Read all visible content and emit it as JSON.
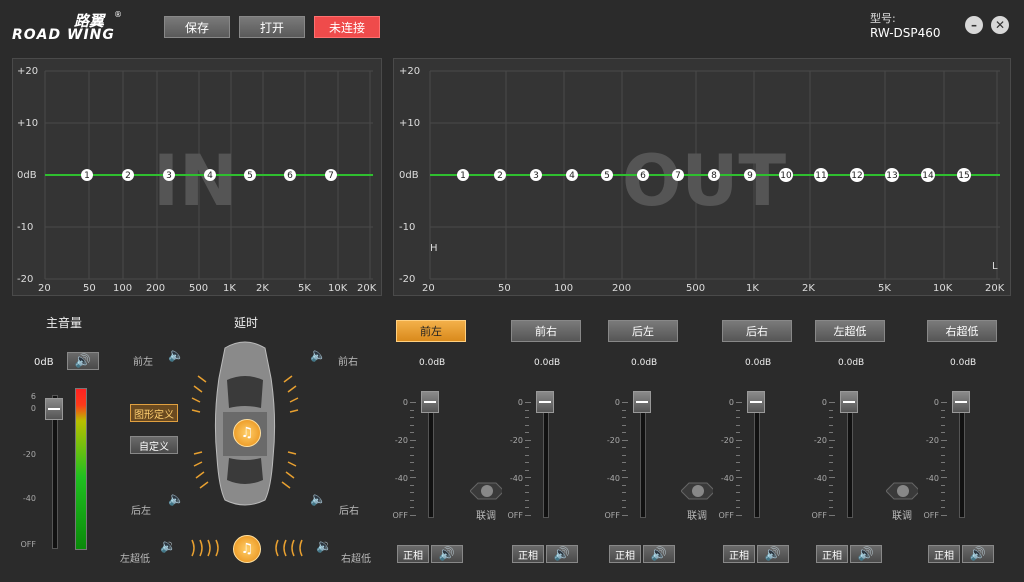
{
  "header": {
    "logo_cn": "路翼",
    "logo_reg": "®",
    "logo_en": "ROAD WING",
    "save": "保存",
    "open": "打开",
    "status": "未连接",
    "model_label": "型号:",
    "model_value": "RW-DSP460",
    "minimize": "–",
    "close": "✕"
  },
  "eq_in": {
    "watermark": "IN",
    "y_ticks": [
      "+20",
      "+10",
      "0dB",
      "-10",
      "-20"
    ],
    "x_ticks": [
      "20",
      "50",
      "100",
      "200",
      "500",
      "1K",
      "2K",
      "5K",
      "10K",
      "20K"
    ],
    "points": [
      "1",
      "2",
      "3",
      "4",
      "5",
      "6",
      "7"
    ]
  },
  "eq_out": {
    "watermark": "OUT",
    "y_ticks": [
      "+20",
      "+10",
      "0dB",
      "-10",
      "-20"
    ],
    "x_ticks": [
      "20",
      "50",
      "100",
      "200",
      "500",
      "1K",
      "2K",
      "5K",
      "10K",
      "20K"
    ],
    "points": [
      "1",
      "2",
      "3",
      "4",
      "5",
      "6",
      "7",
      "8",
      "9",
      "10",
      "11",
      "12",
      "13",
      "14",
      "15"
    ],
    "marker_h": "H",
    "marker_l": "L"
  },
  "master": {
    "title": "主音量",
    "value": "0dB",
    "scale": [
      "6",
      "0",
      "-20",
      "-40",
      "OFF"
    ]
  },
  "delay": {
    "title": "延时",
    "front_left": "前左",
    "front_right": "前右",
    "rear_left": "后左",
    "rear_right": "后右",
    "sub_left": "左超低",
    "sub_right": "右超低",
    "graph_define": "图形定义",
    "custom": "自定义"
  },
  "channels": [
    {
      "name": "前左",
      "value": "0.0dB",
      "phase": "正相",
      "active": true
    },
    {
      "name": "前右",
      "value": "0.0dB",
      "phase": "正相",
      "active": false
    },
    {
      "name": "后左",
      "value": "0.0dB",
      "phase": "正相",
      "active": false
    },
    {
      "name": "后右",
      "value": "0.0dB",
      "phase": "正相",
      "active": false
    },
    {
      "name": "左超低",
      "value": "0.0dB",
      "phase": "正相",
      "active": false
    },
    {
      "name": "右超低",
      "value": "0.0dB",
      "phase": "正相",
      "active": false
    }
  ],
  "channel_scale": [
    "0",
    "-20",
    "-40",
    "OFF"
  ],
  "link_label": "联调"
}
